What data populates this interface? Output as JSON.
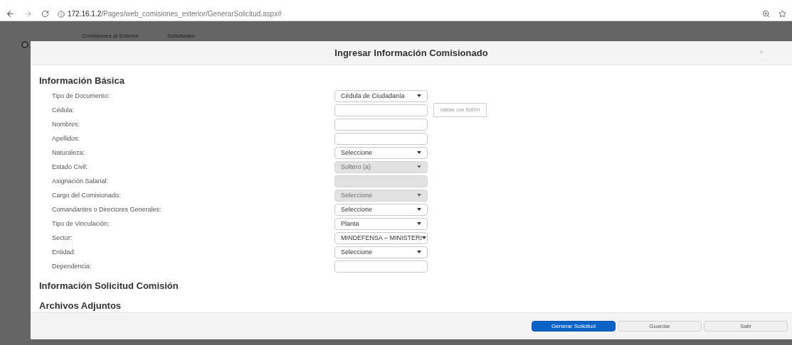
{
  "browser": {
    "url_host": "172.16.1.2",
    "url_path": "/Pages/web_comisiones_exterior/GenerarSolicitud.aspx#"
  },
  "nav": {
    "items": [
      "Comisiones al Exterior",
      "Solicitudes"
    ]
  },
  "modal": {
    "title": "Ingresar Información Comisionado",
    "close": "×"
  },
  "section_title": "Información Básica",
  "fields": [
    {
      "label": "Tipo de Documento:",
      "kind": "select",
      "value": "Cédula de Ciudadanía",
      "disabled": false
    },
    {
      "label": "Cédula:",
      "kind": "text",
      "disabled": false,
      "action": "Validar con SIATH"
    },
    {
      "label": "Nombres:",
      "kind": "text",
      "disabled": false
    },
    {
      "label": "Apellidos:",
      "kind": "text",
      "disabled": false
    },
    {
      "label": "Naturaleza:",
      "kind": "select",
      "value": "Seleccione",
      "disabled": false
    },
    {
      "label": "Estado Civil:",
      "kind": "select",
      "value": "Soltero (a)",
      "disabled": true
    },
    {
      "label": "Asignación Salarial:",
      "kind": "text",
      "disabled": true
    },
    {
      "label": "Cargo del Comisionado:",
      "kind": "select",
      "value": "Seleccione",
      "disabled": true
    },
    {
      "label": "Comandantes o Directores Generales:",
      "kind": "select",
      "value": "Seleccione",
      "disabled": false
    },
    {
      "label": "Tipo de Vinculación:",
      "kind": "select",
      "value": "Planta",
      "disabled": false
    },
    {
      "label": "Sector:",
      "kind": "select",
      "value": "MINDEFENSA – MINISTERI",
      "disabled": false
    },
    {
      "label": "Entidad:",
      "kind": "select",
      "value": "Seleccione",
      "disabled": false
    },
    {
      "label": "Dependencia:",
      "kind": "text",
      "disabled": false
    }
  ],
  "sections": [
    "Información Solicitud Comisión",
    "Archivos Adjuntos"
  ],
  "buttons": [
    {
      "label": "Generar Solicitud",
      "kind": "primary"
    },
    {
      "label": "Guardar",
      "kind": "default"
    },
    {
      "label": "Salir",
      "kind": "default"
    }
  ]
}
